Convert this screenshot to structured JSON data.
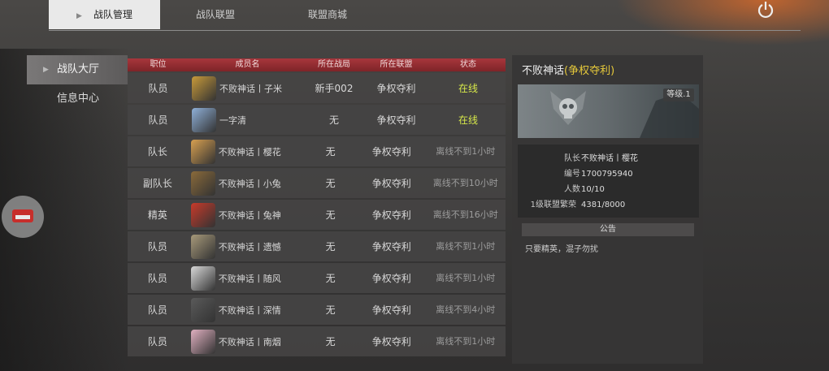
{
  "tabs": [
    {
      "label": "战队管理"
    },
    {
      "label": "战队联盟"
    },
    {
      "label": "联盟商城"
    }
  ],
  "sidebar": {
    "items": [
      {
        "label": "战队大厅"
      },
      {
        "label": "信息中心"
      }
    ]
  },
  "table": {
    "headers": [
      "职位",
      "成员名",
      "所在战局",
      "所在联盟",
      "状态"
    ],
    "rows": [
      {
        "role": "队员",
        "name": "不败神话丨子米",
        "battle": "新手002",
        "alliance": "争权夺利",
        "status": "在线",
        "online": true
      },
      {
        "role": "队员",
        "name": "一字清",
        "battle": "无",
        "alliance": "争权夺利",
        "status": "在线",
        "online": true
      },
      {
        "role": "队长",
        "name": "不败神话丨樱花",
        "battle": "无",
        "alliance": "争权夺利",
        "status": "离线不到1小时",
        "online": false
      },
      {
        "role": "副队长",
        "name": "不败神话丨小兔",
        "battle": "无",
        "alliance": "争权夺利",
        "status": "离线不到10小时",
        "online": false
      },
      {
        "role": "精英",
        "name": "不败神话丨兔神",
        "battle": "无",
        "alliance": "争权夺利",
        "status": "离线不到16小时",
        "online": false
      },
      {
        "role": "队员",
        "name": "不败神话丨遗憾",
        "battle": "无",
        "alliance": "争权夺利",
        "status": "离线不到1小时",
        "online": false
      },
      {
        "role": "队员",
        "name": "不败神话丨随风",
        "battle": "无",
        "alliance": "争权夺利",
        "status": "离线不到1小时",
        "online": false
      },
      {
        "role": "队员",
        "name": "不败神话丨深情",
        "battle": "无",
        "alliance": "争权夺利",
        "status": "离线不到4小时",
        "online": false
      },
      {
        "role": "队员",
        "name": "不败神话丨南烟",
        "battle": "无",
        "alliance": "争权夺利",
        "status": "离线不到1小时",
        "online": false
      }
    ]
  },
  "panel": {
    "team_name": "不败神话",
    "alliance_tag": "(争权夺利)",
    "level": "等级.1",
    "info": [
      {
        "label": "队长",
        "value": "不败神话丨樱花"
      },
      {
        "label": "编号",
        "value": "1700795940"
      },
      {
        "label": "人数",
        "value": "10/10"
      },
      {
        "label": "1级联盟繁荣",
        "value": "4381/8000"
      }
    ],
    "notice_title": "公告",
    "notice_text": "只要精英，混子勿扰"
  },
  "colors": {
    "accent_red": "#a7363c",
    "online": "#d7e84a",
    "tag_gold": "#e5c83a"
  }
}
